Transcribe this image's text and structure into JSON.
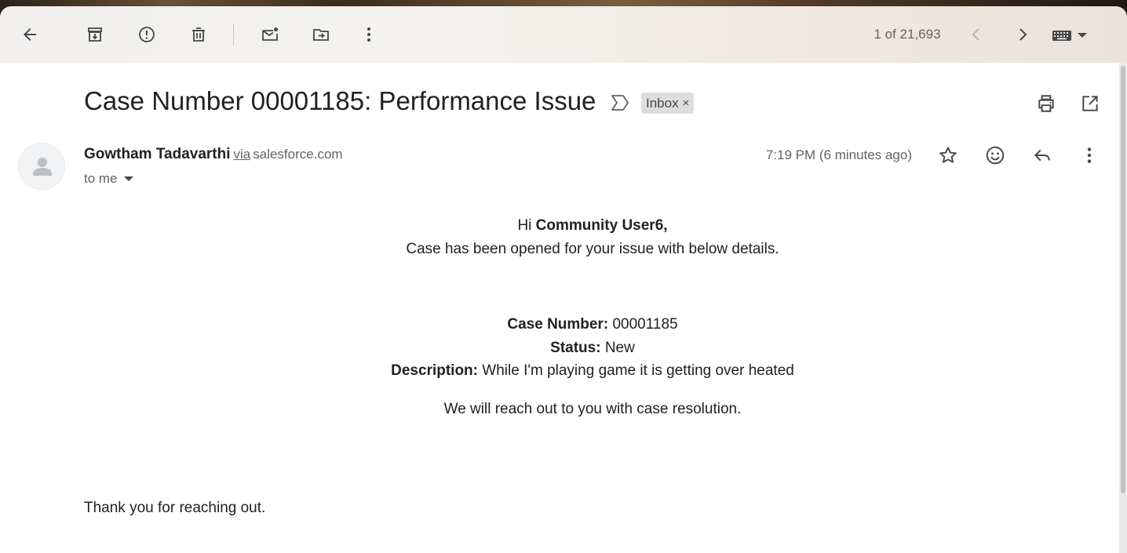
{
  "toolbar": {
    "back": "back-arrow-icon",
    "archive": "archive-icon",
    "report_spam": "report-spam-icon",
    "delete": "delete-icon",
    "mark_unread": "mark-unread-icon",
    "move_to": "move-to-icon",
    "more": "more-vert-icon",
    "pager_text": "1 of 21,693"
  },
  "email": {
    "subject": "Case Number 00001185: Performance Issue",
    "label": "Inbox",
    "label_remove": "×",
    "sender_name": "Gowtham Tadavarthi",
    "via": "via",
    "sender_domain": "salesforce.com",
    "recipient": "to me",
    "timestamp": "7:19 PM (6 minutes ago)"
  },
  "body": {
    "greeting_prefix": "Hi ",
    "greeting_name": "Community User6,",
    "intro": "Case has been opened for your issue with below details.",
    "case_number_label": "Case Number:",
    "case_number_value": " 00001185",
    "status_label": "Status:",
    "status_value": " New",
    "description_label": "Description:",
    "description_value": " While I'm playing game it is getting over heated",
    "followup": "We will reach out to you with case resolution.",
    "closing": "Thank you for reaching out."
  },
  "colors": {
    "text": "#202124",
    "muted": "#5f6368",
    "chip": "#dddddd",
    "background": "#ffffff"
  }
}
